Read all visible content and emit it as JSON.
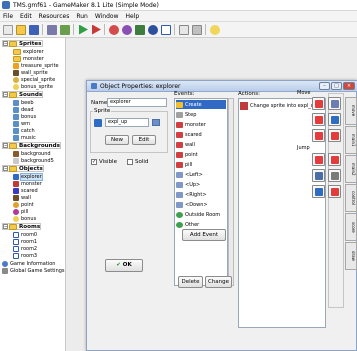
{
  "window": {
    "title": "TMS.gmf61 - GameMaker 8.1 Lite (Simple Mode)"
  },
  "menu": [
    "File",
    "Edit",
    "Resources",
    "Run",
    "Window",
    "Help"
  ],
  "tree": {
    "sprites": {
      "label": "Sprites",
      "items": [
        "explorer",
        "monster",
        "treasure_sprite",
        "wall_sprite",
        "special_sprite",
        "bonus_sprite"
      ]
    },
    "sounds": {
      "label": "Sounds",
      "items": [
        "beeb",
        "dead",
        "bonus",
        "wrn",
        "catch",
        "music"
      ]
    },
    "backgrounds": {
      "label": "Backgrounds",
      "items": [
        "background",
        "background5"
      ]
    },
    "objects": {
      "label": "Objects",
      "items": [
        "explorer",
        "monster",
        "scared",
        "wall",
        "point",
        "pill",
        "bonus"
      ]
    },
    "rooms": {
      "label": "Rooms",
      "items": [
        "room0",
        "room1",
        "room2",
        "room3"
      ]
    },
    "game_information": "Game Information",
    "global_settings": "Global Game Settings"
  },
  "dialog": {
    "title": "Object Properties: explorer",
    "name_label": "Name:",
    "name_value": "explorer",
    "sprite_label": "Sprite",
    "sprite_value": "expl_up",
    "new_button": "New",
    "edit_button": "Edit",
    "visible_label": "Visible",
    "visible_checked": true,
    "solid_label": "Solid",
    "solid_checked": false,
    "ok_button": "OK",
    "events_label": "Events:",
    "events": [
      "Create",
      "Step",
      "monster",
      "scared",
      "wall",
      "point",
      "pill",
      "<Left>",
      "<Up>",
      "<Right>",
      "<Down>",
      "Outside Room",
      "Other"
    ],
    "add_event_button": "Add Event",
    "delete_button": "Delete",
    "change_button": "Change",
    "actions_label": "Actions:",
    "actions": [
      "Change sprite into expl_up"
    ],
    "move_label": "Move",
    "jump_label": "Jump",
    "tabs": [
      "move",
      "main1",
      "main2",
      "control",
      "score",
      "draw"
    ]
  }
}
